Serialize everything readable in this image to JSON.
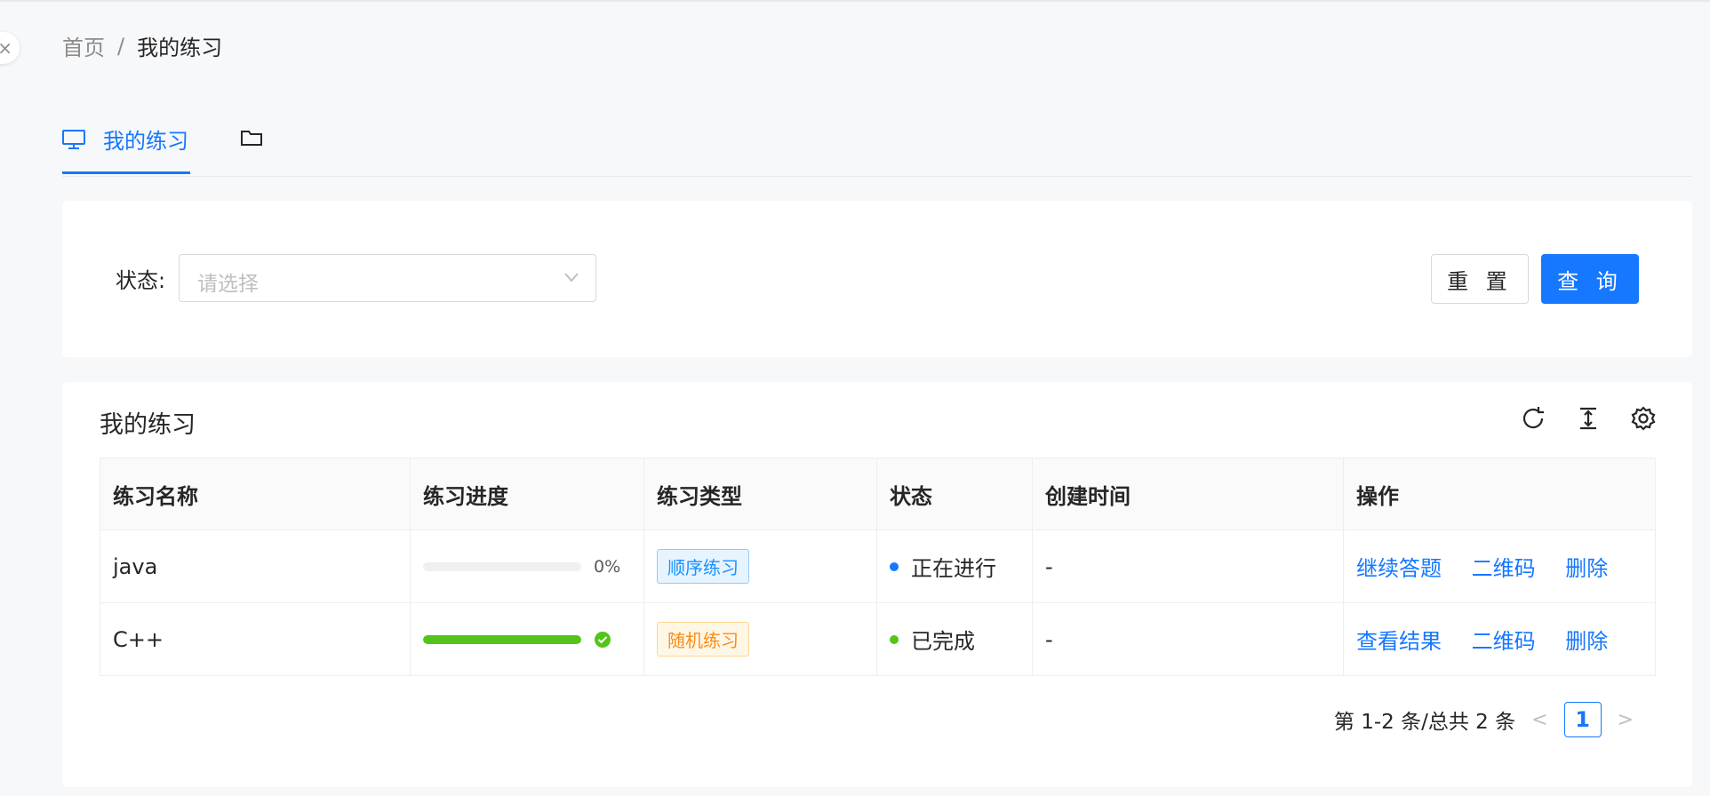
{
  "breadcrumb": {
    "home": "首页",
    "separator": "/",
    "current": "我的练习"
  },
  "tabs": {
    "active_label": "我的练习"
  },
  "filter": {
    "status_label": "状态:",
    "status_placeholder": "请选择",
    "reset_label": "重 置",
    "query_label": "查 询"
  },
  "table": {
    "title": "我的练习",
    "columns": [
      "练习名称",
      "练习进度",
      "练习类型",
      "状态",
      "创建时间",
      "操作"
    ],
    "rows": [
      {
        "name": "java",
        "progress": 0,
        "progress_text": "0%",
        "type": "顺序练习",
        "status": "正在进行",
        "created": "-",
        "actions": [
          "继续答题",
          "二维码",
          "删除"
        ]
      },
      {
        "name": "C++",
        "progress": 1,
        "progress_text": "",
        "type": "随机练习",
        "status": "已完成",
        "created": "-",
        "actions": [
          "查看结果",
          "二维码",
          "删除"
        ]
      }
    ]
  },
  "pagination": {
    "summary": "第 1-2 条/总共 2 条",
    "current_page": "1"
  },
  "colors": {
    "primary": "#1677ff",
    "success": "#52c41a",
    "tag_blue": "#1890ff",
    "tag_orange": "#fa8c16"
  },
  "icons": {
    "tab": "desktop-icon",
    "folder_tab": "folder-icon",
    "select": "chevron-down-icon",
    "refresh": "reload-icon",
    "density": "column-height-icon",
    "settings": "setting-icon",
    "done": "check-circle-icon"
  }
}
